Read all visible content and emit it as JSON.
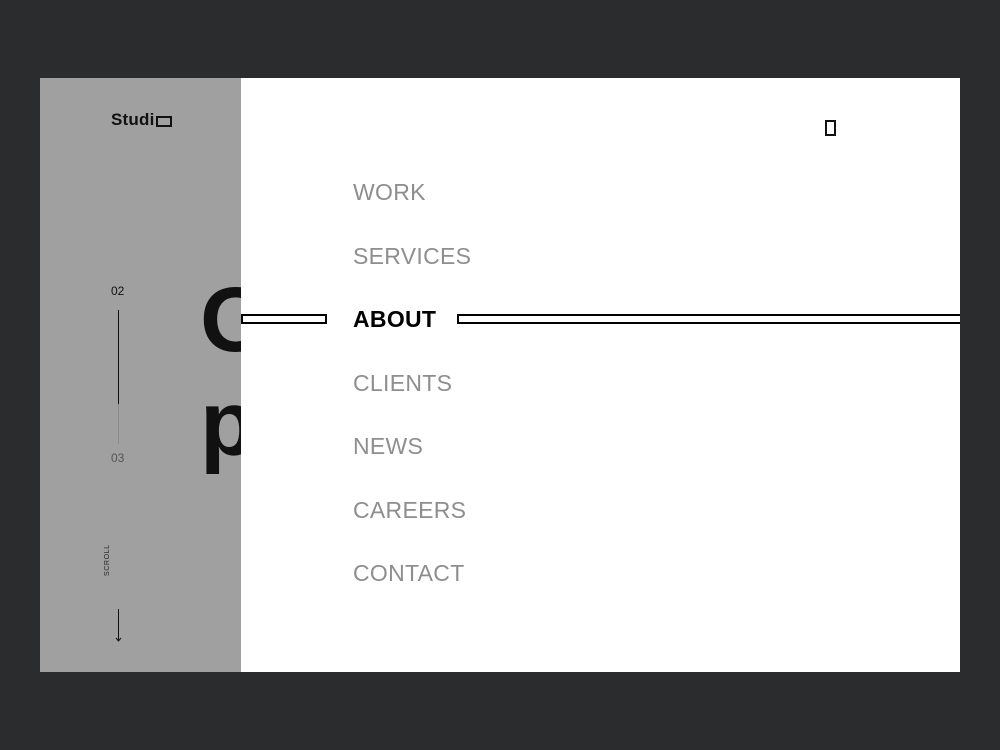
{
  "brand": {
    "logo_text": "Studi",
    "logo_mark_icon": "rectangle-o-icon"
  },
  "slider": {
    "current": "02",
    "next": "03",
    "progress": 0.7
  },
  "scroll": {
    "label": "SCROLL",
    "icon": "arrow-down-icon"
  },
  "hero": {
    "line1": "O",
    "line2": "p"
  },
  "close": {
    "icon": "close-rect-icon"
  },
  "menu": {
    "items": [
      {
        "label": "WORK",
        "active": false
      },
      {
        "label": "SERVICES",
        "active": false
      },
      {
        "label": "ABOUT",
        "active": true
      },
      {
        "label": "CLIENTS",
        "active": false
      },
      {
        "label": "NEWS",
        "active": false
      },
      {
        "label": "CAREERS",
        "active": false
      },
      {
        "label": "CONTACT",
        "active": false
      }
    ]
  },
  "colors": {
    "background": "#2b2c2e",
    "sidebar": "#a0a0a0",
    "panel": "#ffffff",
    "menu_inactive": "#8e8e8e",
    "menu_active": "#000000"
  }
}
